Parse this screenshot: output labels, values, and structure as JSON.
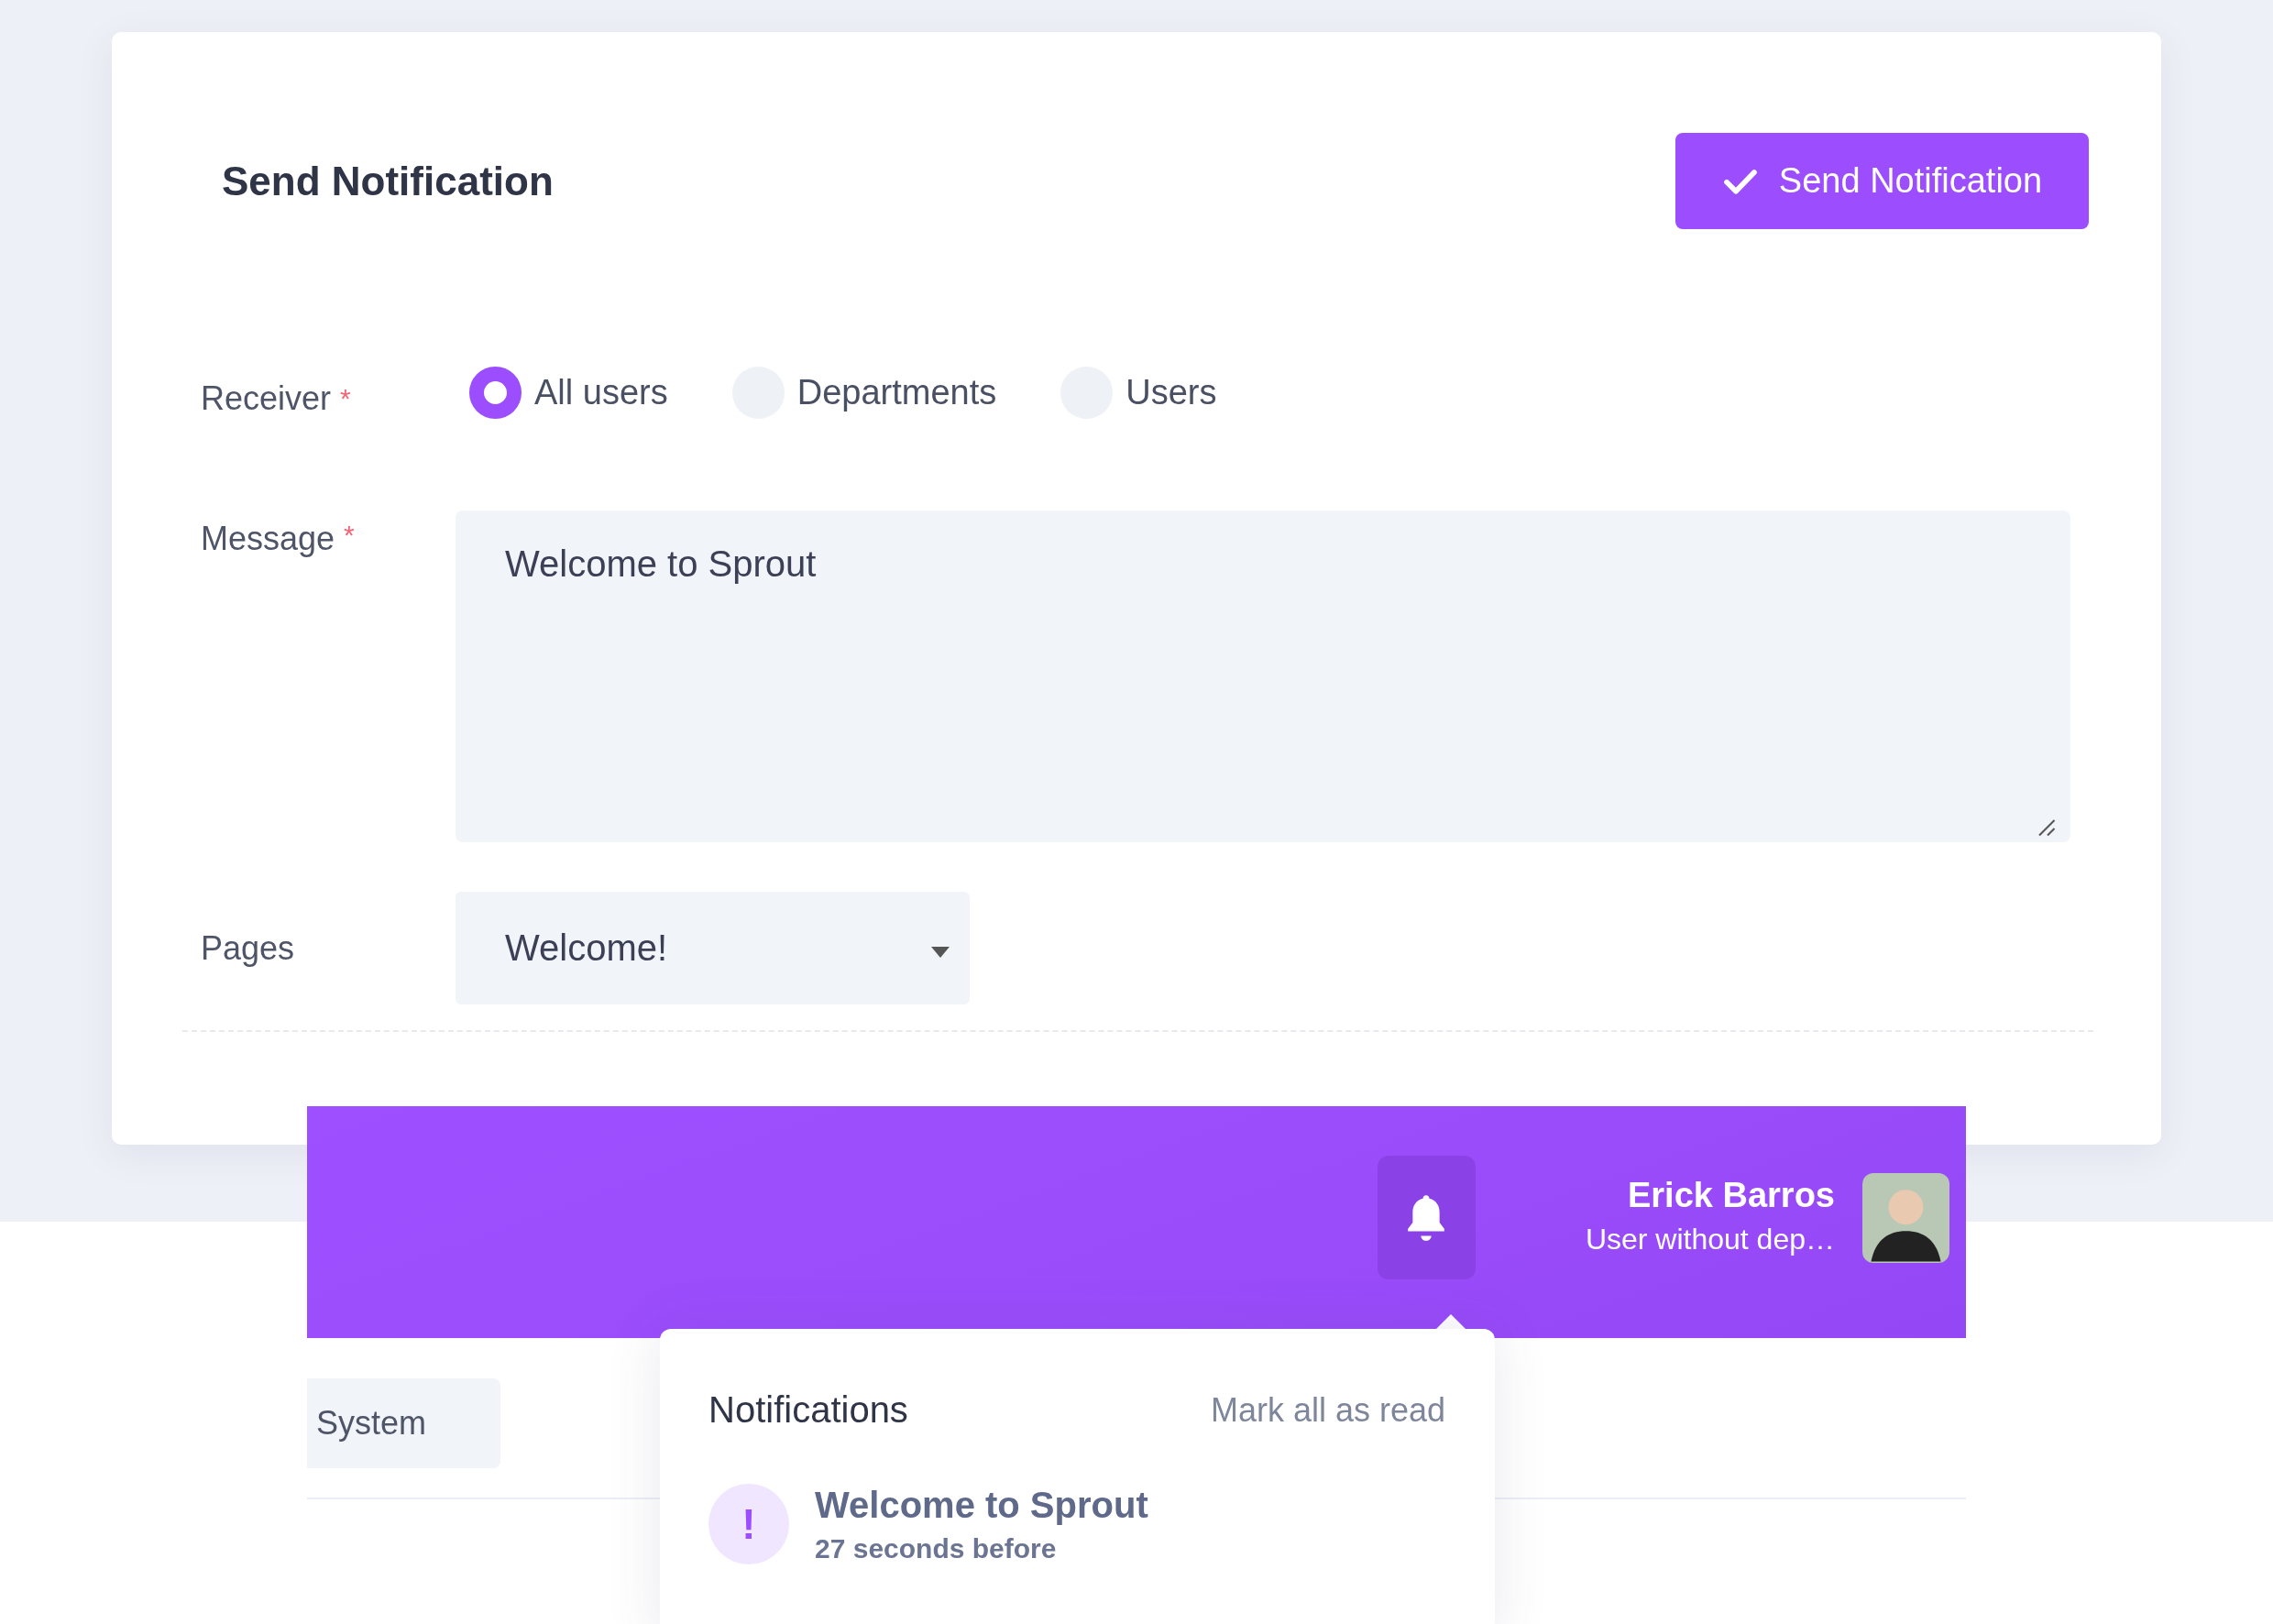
{
  "card": {
    "title": "Send Notification",
    "action_button": {
      "label": "Send Notification"
    }
  },
  "form": {
    "receiver": {
      "label": "Receiver",
      "required_mark": "*",
      "options": [
        {
          "label": "All users",
          "selected": true
        },
        {
          "label": "Departments",
          "selected": false
        },
        {
          "label": "Users",
          "selected": false
        }
      ]
    },
    "message": {
      "label": "Message",
      "required_mark": "*",
      "value": "Welcome to Sprout"
    },
    "pages": {
      "label": "Pages",
      "value": "Welcome!"
    }
  },
  "header": {
    "user_name": "Erick Barros",
    "user_role": "User without dep…"
  },
  "system_tab": {
    "label": "System"
  },
  "notifications": {
    "title": "Notifications",
    "mark_all": "Mark all as read",
    "items": [
      {
        "icon": "!",
        "title": "Welcome to Sprout",
        "time": "27 seconds before"
      }
    ]
  }
}
